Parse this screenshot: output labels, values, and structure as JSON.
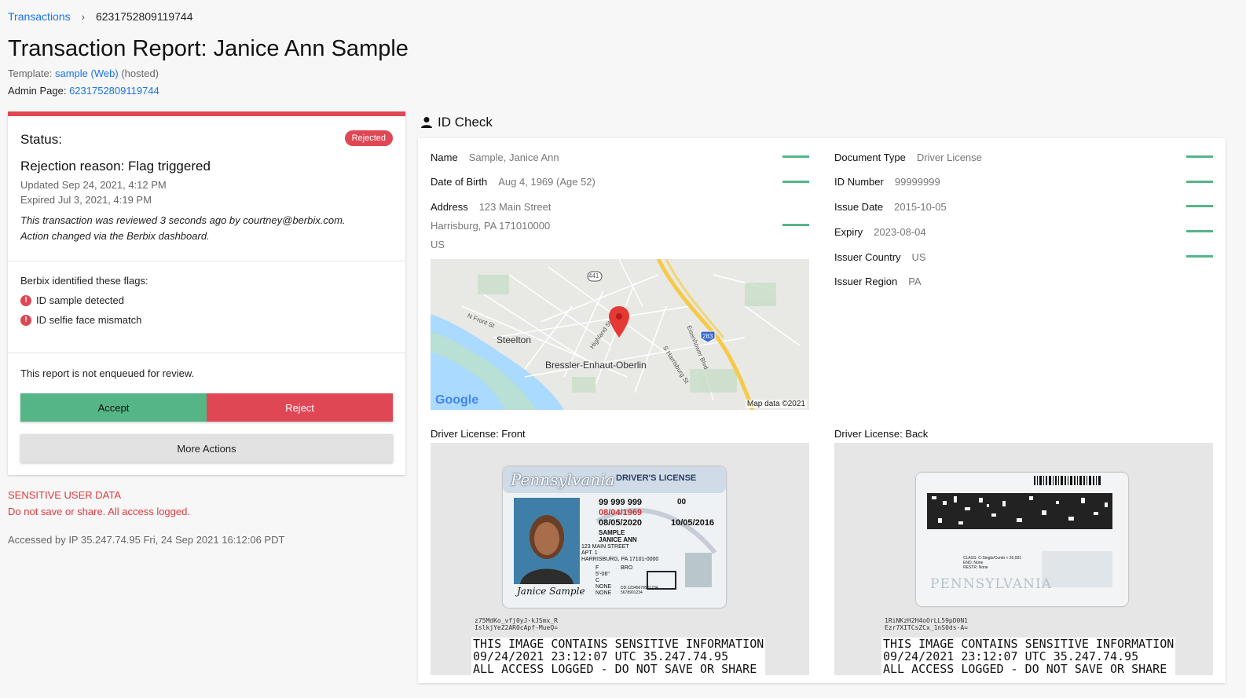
{
  "breadcrumb": {
    "root": "Transactions",
    "current": "6231752809119744"
  },
  "title": "Transaction Report: Janice Ann Sample",
  "template": {
    "label": "Template:",
    "name": "sample (Web)",
    "suffix": "(hosted)"
  },
  "admin": {
    "label": "Admin Page:",
    "link": "6231752809119744"
  },
  "status": {
    "label": "Status:",
    "badge": "Rejected",
    "reason": "Rejection reason: Flag triggered",
    "updated": "Updated Sep 24, 2021, 4:12 PM",
    "expired": "Expired Jul 3, 2021, 4:19 PM",
    "note_line1": "This transaction was reviewed 3 seconds ago by courtney@berbix.com.",
    "note_line2": "Action changed via the Berbix dashboard."
  },
  "flags": {
    "title": "Berbix identified these flags:",
    "items": [
      "ID sample detected",
      "ID selfie face mismatch"
    ]
  },
  "review": {
    "enqueue_text": "This report is not enqueued for review.",
    "accept_label": "Accept",
    "reject_label": "Reject",
    "more_label": "More Actions"
  },
  "sensitive": {
    "line1": "SENSITIVE USER DATA",
    "line2": "Do not save or share. All access logged.",
    "accessed": "Accessed by IP 35.247.74.95 Fri, 24 Sep 2021 16:12:06 PDT"
  },
  "idcheck": {
    "heading": "ID Check",
    "left_fields": [
      {
        "label": "Name",
        "value": "Sample, Janice Ann"
      },
      {
        "label": "Date of Birth",
        "value": "Aug 4, 1969 (Age 52)"
      },
      {
        "label": "Address",
        "value": "123 Main Street",
        "line2": "Harrisburg, PA 171010000",
        "line3": "US"
      }
    ],
    "right_fields": [
      {
        "label": "Document Type",
        "value": "Driver License"
      },
      {
        "label": "ID Number",
        "value": "99999999"
      },
      {
        "label": "Issue Date",
        "value": "2015-10-05"
      },
      {
        "label": "Expiry",
        "value": "2023-08-04"
      },
      {
        "label": "Issuer Country",
        "value": "US"
      },
      {
        "label": "Issuer Region",
        "value": "PA"
      }
    ],
    "map": {
      "labels": [
        "Steelton",
        "Bressler-Enhaut-Oberlin",
        "N Front St",
        "Highland St",
        "Eisenhower Blvd",
        "S Harrisburg St"
      ],
      "route_441": "441",
      "route_283": "283",
      "brand": "Google",
      "attribution": "Map data ©2021"
    },
    "front_title": "Driver License: Front",
    "back_title": "Driver License: Back",
    "front_card": {
      "state": "Pennsylvania",
      "type": "DRIVER'S LICENSE",
      "dln": "99 999 999",
      "dob": "08/04/1969",
      "exp": "08/05/2020",
      "dups": "00",
      "iss": "10/05/2016",
      "name": "SAMPLE\nJANICE ANN",
      "addr": "123 MAIN STREET\nAPT. 1\nHARRISBURG, PA 17101-0000",
      "sex": "F",
      "eyes": "BRO",
      "hgt": "5'-06\"",
      "cls": "C",
      "end": "NONE",
      "rest": "NONE",
      "dd": "DD:12345678901234\n5678901234"
    },
    "back_card": {
      "state": "PENNSYLVANIA",
      "class": "CLASS: C-Single/Comb < 26,001",
      "end": "END: None",
      "restr": "RESTR: None"
    },
    "hash_front": "z75MdKo_vfj0yJ-kJSmx_R\nIslkjYeZ2AR0cApf-MueQ=",
    "hash_back": "1RiNKzH2H4oOrLL59pD0N1\nEzr7XITCsZCx_1nS0ds-A=",
    "watermark": "THIS IMAGE CONTAINS SENSITIVE INFORMATION\n09/24/2021 23:12:07 UTC 35.247.74.95\nALL ACCESS LOGGED - DO NOT SAVE OR SHARE"
  },
  "colors": {
    "accent": "#1a73e8",
    "reject": "#e04755",
    "accept": "#55b586",
    "ok": "#55b586"
  }
}
